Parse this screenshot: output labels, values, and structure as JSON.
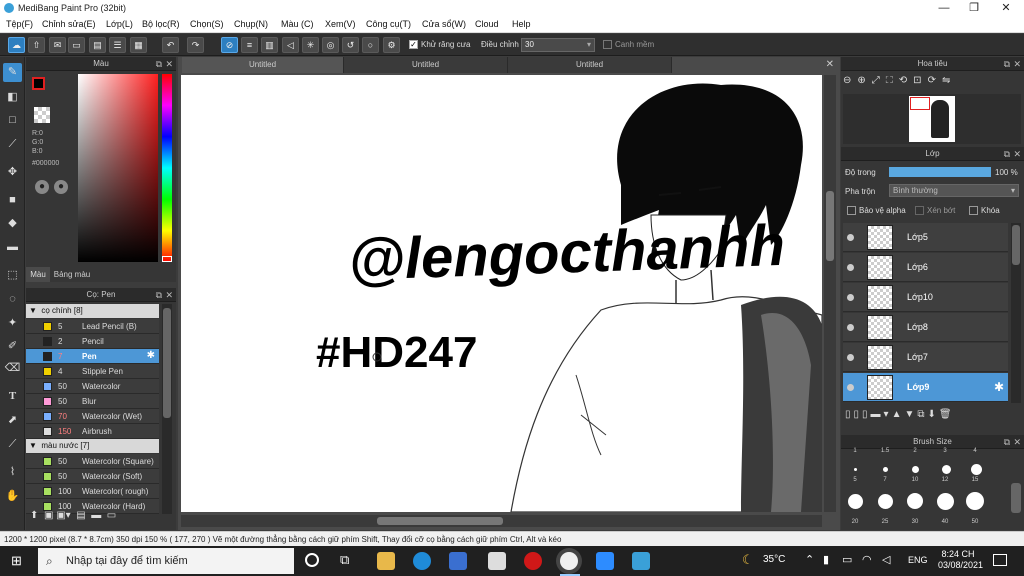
{
  "window": {
    "title": "MediBang Paint Pro (32bit)",
    "minimize": "—",
    "maximize": "❐",
    "close": "✕"
  },
  "menu": [
    "Tệp(F)",
    "Chỉnh sửa(E)",
    "Lớp(L)",
    "Bộ lọc(R)",
    "Chọn(S)",
    "Chụp(N)",
    "Màu (C)",
    "Xem(V)",
    "Công cụ(T)",
    "Cửa sổ(W)",
    "Cloud",
    "Help"
  ],
  "toolbar": {
    "antialias_label": "Khử răng cưa",
    "adjust_label": "Điều chỉnh",
    "adjust_value": "30",
    "edge_label": "Canh mềm"
  },
  "color_panel": {
    "title": "Màu",
    "r": "R:0",
    "g": "G:0",
    "b": "B:0",
    "hex": "#000000",
    "tab_color": "Màu",
    "tab_palette": "Bảng màu"
  },
  "brush_panel": {
    "title": "Cọ: Pen",
    "group1": "cọ chính [8]",
    "brushes": [
      {
        "size": "5",
        "name": "Lead Pencil (B)",
        "color": "#f0d000"
      },
      {
        "size": "2",
        "name": "Pencil",
        "color": "#222222"
      },
      {
        "size": "7",
        "name": "Pen",
        "color": "#222222"
      },
      {
        "size": "4",
        "name": "Stipple Pen",
        "color": "#f0d000"
      },
      {
        "size": "50",
        "name": "Watercolor",
        "color": "#7ab0ff"
      },
      {
        "size": "50",
        "name": "Blur",
        "color": "#ff9ad8"
      },
      {
        "size": "70",
        "name": "Watercolor (Wet)",
        "color": "#7ab0ff"
      },
      {
        "size": "150",
        "name": "Airbrush",
        "color": "#dddddd"
      }
    ],
    "group2": "màu nước [7]",
    "brushes2": [
      {
        "size": "50",
        "name": "Watercolor (Square)",
        "color": "#a8e060"
      },
      {
        "size": "50",
        "name": "Watercolor (Soft)",
        "color": "#a8e060"
      },
      {
        "size": "100",
        "name": "Watercolor( rough)",
        "color": "#a8e060"
      },
      {
        "size": "100",
        "name": "Watercolor (Hard)",
        "color": "#a8e060"
      }
    ]
  },
  "tabs": [
    "Untitled",
    "Untitled",
    "Untitled"
  ],
  "canvas": {
    "text1": "@lengocthanhh",
    "text2": "#HD247"
  },
  "navigator": {
    "title": "Hoa tiêu"
  },
  "layer_panel": {
    "title": "Lớp",
    "opacity_label": "Độ trong",
    "opacity_value": "100 %",
    "blend_label": "Pha trộn",
    "blend_value": "Bình thường",
    "protect_alpha": "Bảo vệ alpha",
    "clipping": "Xén bớt",
    "lock": "Khóa",
    "layers": [
      "Lớp5",
      "Lớp6",
      "Lớp10",
      "Lớp8",
      "Lớp7",
      "Lớp9"
    ]
  },
  "brush_size": {
    "title": "Brush Size",
    "labels_top": [
      "1",
      "1.5",
      "2",
      "3",
      "4"
    ],
    "labels": [
      "5",
      "7",
      "10",
      "12",
      "15",
      "20",
      "25",
      "30",
      "40",
      "50"
    ]
  },
  "status": "1200 * 1200 pixel  (8.7 * 8.7cm)  350 dpi  150 %  ( 177, 270 )  Vẽ một đường thẳng bằng cách giữ phím Shift, Thay đổi cỡ cọ bằng cách giữ phím Ctrl, Alt và kéo",
  "taskbar": {
    "search_placeholder": "Nhập tại đây để tìm kiếm",
    "weather": "35°C",
    "lang": "ENG",
    "time": "8:24 CH",
    "date": "03/08/2021"
  }
}
